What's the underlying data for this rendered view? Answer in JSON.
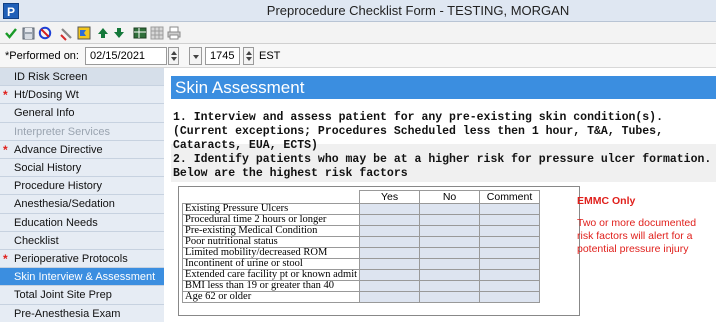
{
  "window": {
    "app_icon": "P",
    "title": "Preprocedure Checklist Form - TESTING, MORGAN"
  },
  "toolbar": {
    "icons": [
      "check-icon",
      "save-icon",
      "cancel-icon",
      "tools-icon",
      "flag-icon",
      "up-arrow-icon",
      "down-arrow-icon",
      "table-icon",
      "grid-icon",
      "print-icon"
    ]
  },
  "performed": {
    "label": "*Performed on:",
    "date": "02/15/2021",
    "time": "1745",
    "timezone": "EST"
  },
  "sidebar": {
    "items": [
      {
        "label": "ID Risk Screen",
        "required": false,
        "state": "normal"
      },
      {
        "label": "Ht/Dosing Wt",
        "required": true,
        "state": "normal"
      },
      {
        "label": "General Info",
        "required": false,
        "state": "normal"
      },
      {
        "label": "Interpreter Services",
        "required": false,
        "state": "disabled"
      },
      {
        "label": "Advance Directive",
        "required": true,
        "state": "normal"
      },
      {
        "label": "Social History",
        "required": false,
        "state": "normal"
      },
      {
        "label": "Procedure History",
        "required": false,
        "state": "normal"
      },
      {
        "label": "Anesthesia/Sedation",
        "required": false,
        "state": "normal"
      },
      {
        "label": "Education Needs",
        "required": false,
        "state": "normal"
      },
      {
        "label": "Checklist",
        "required": false,
        "state": "normal"
      },
      {
        "label": "Perioperative Protocols",
        "required": true,
        "state": "normal"
      },
      {
        "label": "Skin Interview & Assessment",
        "required": false,
        "state": "active"
      },
      {
        "label": "Total Joint Site Prep",
        "required": false,
        "state": "normal"
      },
      {
        "label": "Pre-Anesthesia Exam",
        "required": false,
        "state": "normal"
      }
    ],
    "required_marker": "*"
  },
  "content": {
    "section_title": "Skin Assessment",
    "question1": "1. Interview and assess patient for any pre-existing skin condition(s).  (Current exceptions; Procedures Scheduled less then 1 hour, T&A, Tubes, Cataracts, EUA, ECTS)",
    "question2": "2. Identify patients who may be at a higher risk for pressure ulcer formation.  Below are the highest risk factors",
    "table": {
      "columns": [
        "Yes",
        "No",
        "Comment"
      ],
      "rows": [
        "Existing Pressure Ulcers",
        "Procedural time 2 hours or longer",
        "Pre-existing Medical Condition",
        "Poor nutritional status",
        "Limited mobility/decreased ROM",
        "Incontinent of urine or stool",
        "Extended care facility pt or known admit",
        "BMI less than 19 or greater than 40",
        "Age 62 or older"
      ]
    },
    "emmc_label": "EMMC Only",
    "emmc_note": "Two or more documented risk factors will alert for a  potential pressure injury"
  },
  "colors": {
    "accent": "#3b8ee0",
    "required": "#e0201c",
    "cell_fill": "#dde4f0"
  }
}
